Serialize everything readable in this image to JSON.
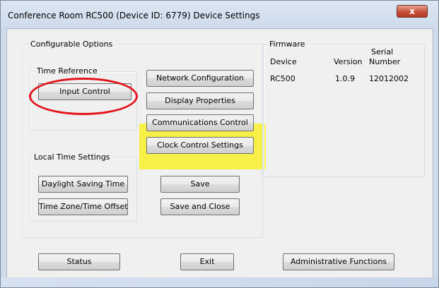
{
  "window": {
    "title": "Conference Room RC500 (Device ID: 6779) Device Settings",
    "close_glyph": "x"
  },
  "configurable": {
    "legend": "Configurable Options",
    "time_reference": {
      "legend": "Time Reference",
      "input_control": "Input Control"
    },
    "local_time": {
      "legend": "Local Time Settings",
      "daylight_saving": "Daylight Saving Time",
      "time_zone": "Time Zone/Time Offset"
    },
    "buttons": {
      "network": "Network Configuration",
      "display": "Display Properties",
      "communications": "Communications Control",
      "clock": "Clock Control Settings",
      "save": "Save",
      "save_close": "Save and Close"
    }
  },
  "firmware": {
    "legend": "Firmware",
    "headers": {
      "device": "Device",
      "version": "Version",
      "serial_line1": "Serial",
      "serial_line2": "Number"
    },
    "row": {
      "device": "RC500",
      "version": "1.0.9",
      "serial": "12012002"
    }
  },
  "footer": {
    "status": "Status",
    "exit": "Exit",
    "admin": "Administrative Functions"
  },
  "annotations": {
    "highlight_color": "#f7f03a",
    "circle_color": "#e2141b"
  }
}
